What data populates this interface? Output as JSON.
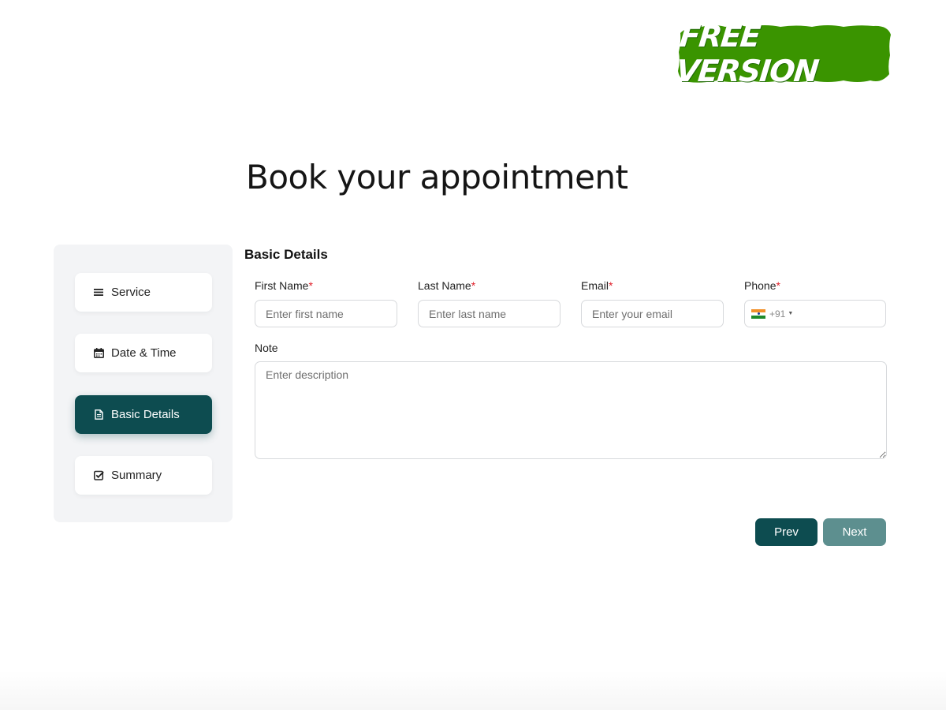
{
  "badge": {
    "text": "FREE VERSION",
    "color": "#3a9400"
  },
  "page_title": "Book your appointment",
  "sidebar": {
    "steps": [
      {
        "label": "Service",
        "icon": "list-icon",
        "active": false
      },
      {
        "label": "Date & Time",
        "icon": "calendar-icon",
        "active": false
      },
      {
        "label": "Basic Details",
        "icon": "document-icon",
        "active": true
      },
      {
        "label": "Summary",
        "icon": "checkbox-icon",
        "active": false
      }
    ]
  },
  "form": {
    "section_title": "Basic Details",
    "required_mark": "*",
    "first_name": {
      "label": "First Name",
      "placeholder": "Enter first name",
      "value": ""
    },
    "last_name": {
      "label": "Last Name",
      "placeholder": "Enter last name",
      "value": ""
    },
    "email": {
      "label": "Email",
      "placeholder": "Enter your email",
      "value": ""
    },
    "phone": {
      "label": "Phone",
      "country_icon": "india-flag-icon",
      "dial_code": "+91",
      "value": ""
    },
    "note": {
      "label": "Note",
      "placeholder": "Enter description",
      "value": ""
    }
  },
  "buttons": {
    "prev": "Prev",
    "next": "Next"
  },
  "colors": {
    "primary": "#0d4c50",
    "next_button": "#5d8f8f",
    "required": "#e0202a",
    "sidebar_bg": "#f3f4f6"
  }
}
